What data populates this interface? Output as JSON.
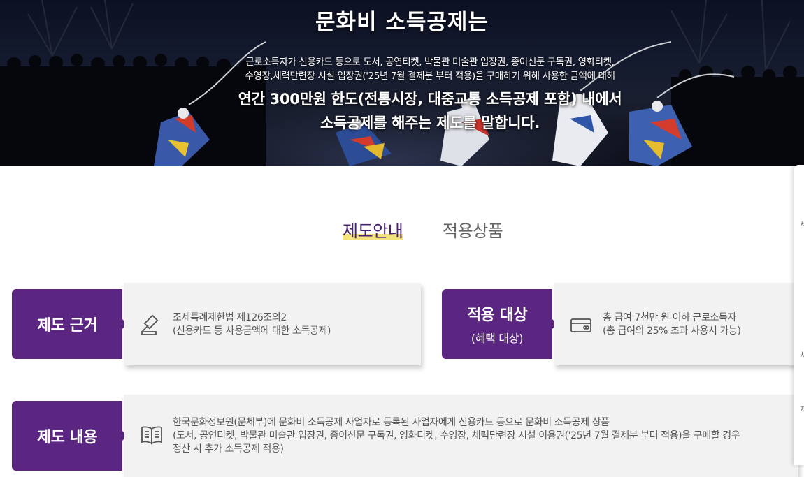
{
  "hero": {
    "title": "문화비 소득공제는",
    "desc_line1": "근로소득자가 신용카드 등으로 도서, 공연티켓, 박물관 미술관 입장권, 종이신문 구독권, 영화티켓,",
    "desc_line2": "수영장,체력단련장 시설 입장권('25년 7월 결제분 부터 적용)을 구매하기 위해 사용한 금액에 대해",
    "strong_line1": "연간 300만원 한도(전통시장, 대중교통 소득공제 포함) 내에서",
    "strong_line2": "소득공제를 해주는 제도를 말합니다."
  },
  "tabs": [
    {
      "label": "제도안내",
      "active": true
    },
    {
      "label": "적용상품",
      "active": false
    }
  ],
  "cards": {
    "basis": {
      "label": "제도 근거",
      "icon": "gavel-icon",
      "line1": "조세특례제한법 제126조의2",
      "line2": "(신용카드 등 사용금액에 대한 소득공제)"
    },
    "target": {
      "label": "적용 대상",
      "sublabel": "(혜택 대상)",
      "icon": "credit-card-icon",
      "line1": "총 급여 7천만 원 이하 근로소득자",
      "line2": "(총 급여의 25% 초과 사용시 가능)"
    },
    "content": {
      "label": "제도 내용",
      "icon": "open-book-icon",
      "line1": "한국문화정보원(문체부)에 문화비 소득공제 사업자로 등록된 사업자에게 신용카드 등으로 문화비 소득공제 상품",
      "line2": "(도서, 공연티켓, 박물관 미술관 입장권, 종이신문 구독권, 영화티켓, 수영장, 체력단련장 시설 이용권('25년 7월 결제분 부터 적용)을 구매할 경우",
      "line3": "정산 시 추가 소득공제 적용)"
    }
  },
  "side_panel": {
    "marks": [
      "서",
      "치",
      "지"
    ]
  },
  "colors": {
    "purple": "#5b2582",
    "highlight": "#f3e37a",
    "card_bg": "#f2f2f2"
  }
}
